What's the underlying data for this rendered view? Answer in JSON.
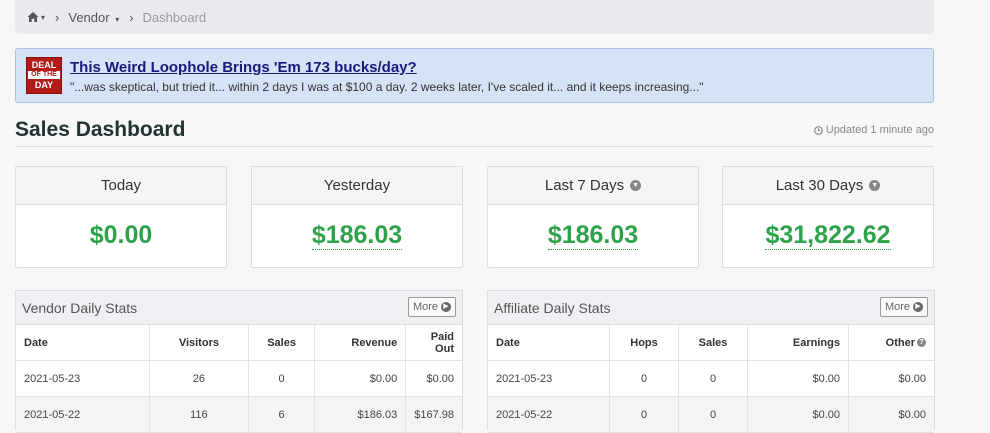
{
  "breadcrumb": {
    "home_caret": "▾",
    "vendor": "Vendor",
    "vendor_caret": "▾",
    "current": "Dashboard"
  },
  "ad": {
    "logo_top": "DEAL",
    "logo_mid": "OF THE",
    "logo_bottom": "DAY",
    "headline": "This Weird Loophole Brings 'Em 173 bucks/day?",
    "quote": "\"...was skeptical, but tried it... within 2 days I was at $100 a day. 2 weeks later, I've scaled it... and it keeps increasing...\""
  },
  "page": {
    "title": "Sales Dashboard",
    "updated": "Updated 1 minute ago"
  },
  "cards": [
    {
      "label": "Today",
      "value": "$0.00"
    },
    {
      "label": "Yesterday",
      "value": "$186.03"
    },
    {
      "label": "Last 7 Days",
      "value": "$186.03"
    },
    {
      "label": "Last 30 Days",
      "value": "$31,822.62"
    }
  ],
  "vendor_stats": {
    "title": "Vendor Daily Stats",
    "more": "More",
    "columns": [
      "Date",
      "Visitors",
      "Sales",
      "Revenue",
      "Paid Out"
    ],
    "rows": [
      [
        "2021-05-23",
        "26",
        "0",
        "$0.00",
        "$0.00"
      ],
      [
        "2021-05-22",
        "116",
        "6",
        "$186.03",
        "$167.98"
      ]
    ]
  },
  "affiliate_stats": {
    "title": "Affiliate Daily Stats",
    "more": "More",
    "columns": [
      "Date",
      "Hops",
      "Sales",
      "Earnings",
      "Other"
    ],
    "rows": [
      [
        "2021-05-23",
        "0",
        "0",
        "$0.00",
        "$0.00"
      ],
      [
        "2021-05-22",
        "0",
        "0",
        "$0.00",
        "$0.00"
      ]
    ]
  },
  "colors": {
    "accent_green": "#2ea24a",
    "ad_background": "#d4e3f5",
    "ad_headline": "#1a1a7a"
  },
  "icons": [
    "home-icon",
    "clock-icon",
    "chevron-circle-down-icon",
    "chevron-circle-right-icon",
    "question-circle-icon"
  ]
}
